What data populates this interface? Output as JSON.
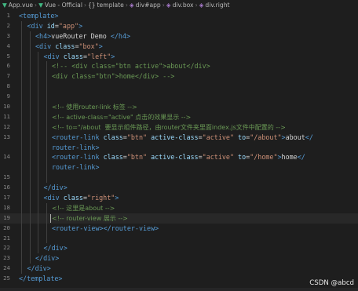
{
  "breadcrumb": {
    "items": [
      {
        "icon": "vue-icon",
        "label": "App.vue"
      },
      {
        "icon": "vue-icon",
        "label": "Vue - Official"
      },
      {
        "icon": "braces-icon",
        "label": "template"
      },
      {
        "icon": "cube-icon",
        "label": "div#app"
      },
      {
        "icon": "cube-icon",
        "label": "div.box"
      },
      {
        "icon": "cube-icon",
        "label": "div.right"
      }
    ]
  },
  "editor": {
    "lines": [
      {
        "n": "1",
        "indent": 0,
        "tokens": [
          [
            "tag",
            "<template>"
          ]
        ]
      },
      {
        "n": "2",
        "indent": 1,
        "tokens": [
          [
            "tag",
            "<div"
          ],
          [
            "t",
            " "
          ],
          [
            "attr",
            "id"
          ],
          [
            "eq",
            "="
          ],
          [
            "str",
            "\"app\""
          ],
          [
            "tag",
            ">"
          ]
        ]
      },
      {
        "n": "3",
        "indent": 2,
        "tokens": [
          [
            "tag",
            "<h4>"
          ],
          [
            "t",
            "vueRouter Demo "
          ],
          [
            "tag",
            "</h4>"
          ]
        ]
      },
      {
        "n": "4",
        "indent": 2,
        "tokens": [
          [
            "tag",
            "<div"
          ],
          [
            "t",
            " "
          ],
          [
            "attr",
            "class"
          ],
          [
            "eq",
            "="
          ],
          [
            "str",
            "\"box\""
          ],
          [
            "tag",
            ">"
          ]
        ]
      },
      {
        "n": "5",
        "indent": 3,
        "tokens": [
          [
            "tag",
            "<div"
          ],
          [
            "t",
            " "
          ],
          [
            "attr",
            "class"
          ],
          [
            "eq",
            "="
          ],
          [
            "str",
            "\"left\""
          ],
          [
            "tag",
            ">"
          ]
        ]
      },
      {
        "n": "6",
        "indent": 4,
        "tokens": [
          [
            "com",
            "<!-- <div class=\"btn active\">about</div>"
          ]
        ]
      },
      {
        "n": "7",
        "indent": 4,
        "tokens": [
          [
            "com",
            "<div class=\"btn\">home</div> -->"
          ]
        ]
      },
      {
        "n": "8",
        "indent": 4,
        "tokens": []
      },
      {
        "n": "9",
        "indent": 4,
        "tokens": []
      },
      {
        "n": "10",
        "indent": 4,
        "tokens": [
          [
            "com",
            "<!-- 使用router-link 标签 -->"
          ]
        ]
      },
      {
        "n": "11",
        "indent": 4,
        "tokens": [
          [
            "com",
            "<!-- active-class=\"active\" 点击的效果显示 -->"
          ]
        ]
      },
      {
        "n": "12",
        "indent": 4,
        "tokens": [
          [
            "com",
            "<!-- to=\"/about  要显示组件路径，由router文件夹里面index.js文件中配置的 -->"
          ]
        ]
      },
      {
        "n": "13",
        "indent": 4,
        "tokens": [
          [
            "tag",
            "<router-link"
          ],
          [
            "t",
            " "
          ],
          [
            "attr",
            "class"
          ],
          [
            "eq",
            "="
          ],
          [
            "str",
            "\"btn\""
          ],
          [
            "t",
            " "
          ],
          [
            "attr",
            "active-class"
          ],
          [
            "eq",
            "="
          ],
          [
            "str",
            "\"active\""
          ],
          [
            "t",
            " "
          ],
          [
            "attr",
            "to"
          ],
          [
            "eq",
            "="
          ],
          [
            "str",
            "\"/about\""
          ],
          [
            "tag",
            ">"
          ],
          [
            "t",
            "about"
          ],
          [
            "tag",
            "</"
          ]
        ]
      },
      {
        "n": "",
        "indent": 4,
        "tokens": [
          [
            "tag",
            "router-link"
          ],
          [
            "tag",
            ">"
          ]
        ]
      },
      {
        "n": "14",
        "indent": 4,
        "tokens": [
          [
            "tag",
            "<router-link"
          ],
          [
            "t",
            " "
          ],
          [
            "attr",
            "class"
          ],
          [
            "eq",
            "="
          ],
          [
            "str",
            "\"btn\""
          ],
          [
            "t",
            " "
          ],
          [
            "attr",
            "active-class"
          ],
          [
            "eq",
            "="
          ],
          [
            "str",
            "\"active\""
          ],
          [
            "t",
            " "
          ],
          [
            "attr",
            "to"
          ],
          [
            "eq",
            "="
          ],
          [
            "str",
            "\"/home\""
          ],
          [
            "tag",
            ">"
          ],
          [
            "t",
            "home"
          ],
          [
            "tag",
            "</"
          ]
        ]
      },
      {
        "n": "",
        "indent": 4,
        "tokens": [
          [
            "tag",
            "router-link"
          ],
          [
            "tag",
            ">"
          ]
        ]
      },
      {
        "n": "15",
        "indent": 4,
        "tokens": []
      },
      {
        "n": "16",
        "indent": 3,
        "tokens": [
          [
            "tag",
            "</div>"
          ]
        ]
      },
      {
        "n": "17",
        "indent": 3,
        "tokens": [
          [
            "tag",
            "<div"
          ],
          [
            "t",
            " "
          ],
          [
            "attr",
            "class"
          ],
          [
            "eq",
            "="
          ],
          [
            "str",
            "\"right\""
          ],
          [
            "tag",
            ">"
          ]
        ]
      },
      {
        "n": "18",
        "indent": 4,
        "tokens": [
          [
            "com",
            "<!-- 这里是about -->"
          ]
        ]
      },
      {
        "n": "19",
        "indent": 4,
        "tokens": [
          [
            "com",
            "<!-- router-view 展示 -->"
          ]
        ]
      },
      {
        "n": "20",
        "indent": 4,
        "tokens": [
          [
            "tag",
            "<router-view>"
          ],
          [
            "tag",
            "</router-view>"
          ]
        ]
      },
      {
        "n": "21",
        "indent": 4,
        "tokens": []
      },
      {
        "n": "22",
        "indent": 3,
        "tokens": [
          [
            "tag",
            "</div>"
          ]
        ]
      },
      {
        "n": "23",
        "indent": 2,
        "tokens": [
          [
            "tag",
            "</div>"
          ]
        ]
      },
      {
        "n": "24",
        "indent": 1,
        "tokens": [
          [
            "tag",
            "</div>"
          ]
        ]
      },
      {
        "n": "25",
        "indent": 0,
        "tokens": [
          [
            "tag",
            "</template>"
          ]
        ]
      }
    ]
  },
  "watermark": "CSDN @abcd",
  "colors": {
    "background": "#1e1e1e",
    "tag": "#569cd6",
    "attribute": "#9cdcfe",
    "string": "#ce9178",
    "comment": "#6a9955",
    "text": "#d4d4d4",
    "line_number": "#858585"
  }
}
